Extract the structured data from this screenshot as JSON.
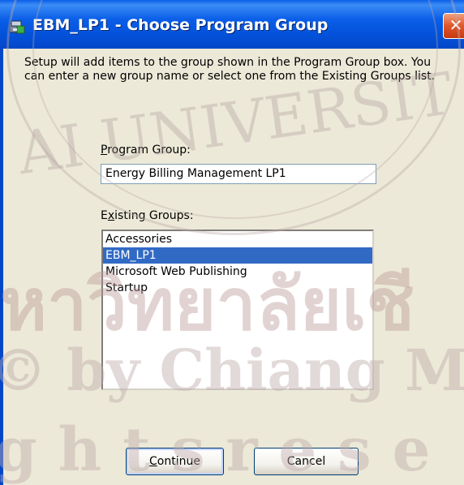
{
  "window": {
    "title": "EBM_LP1 - Choose Program Group",
    "close_glyph": "✕",
    "icon": "setup-package-icon"
  },
  "description": "Setup will add items to the group shown in the Program Group box. You can enter a new group name or select one from the Existing Groups list.",
  "program_group": {
    "label_prefix": "",
    "label_access_key": "P",
    "label_rest": "rogram Group:",
    "value": "Energy Billing Management LP1"
  },
  "existing_groups": {
    "label_prefix": "E",
    "label_access_key": "x",
    "label_rest": "isting Groups:",
    "items": [
      "Accessories",
      "EBM_LP1",
      "Microsoft Web Publishing",
      "Startup"
    ],
    "selected": "EBM_LP1"
  },
  "buttons": {
    "continue_access_key": "C",
    "continue_rest": "ontinue",
    "cancel": "Cancel"
  },
  "watermark": {
    "line1": "AI UNIVERSIT",
    "line2": "หาวิทยาลัยเชี",
    "line3": "© by Chiang Mai U",
    "line4": "g h t s   r e s e"
  },
  "colors": {
    "titlebar": "#0a5ee8",
    "selection": "#316ac5",
    "dialog_bg": "#ece9d8"
  }
}
